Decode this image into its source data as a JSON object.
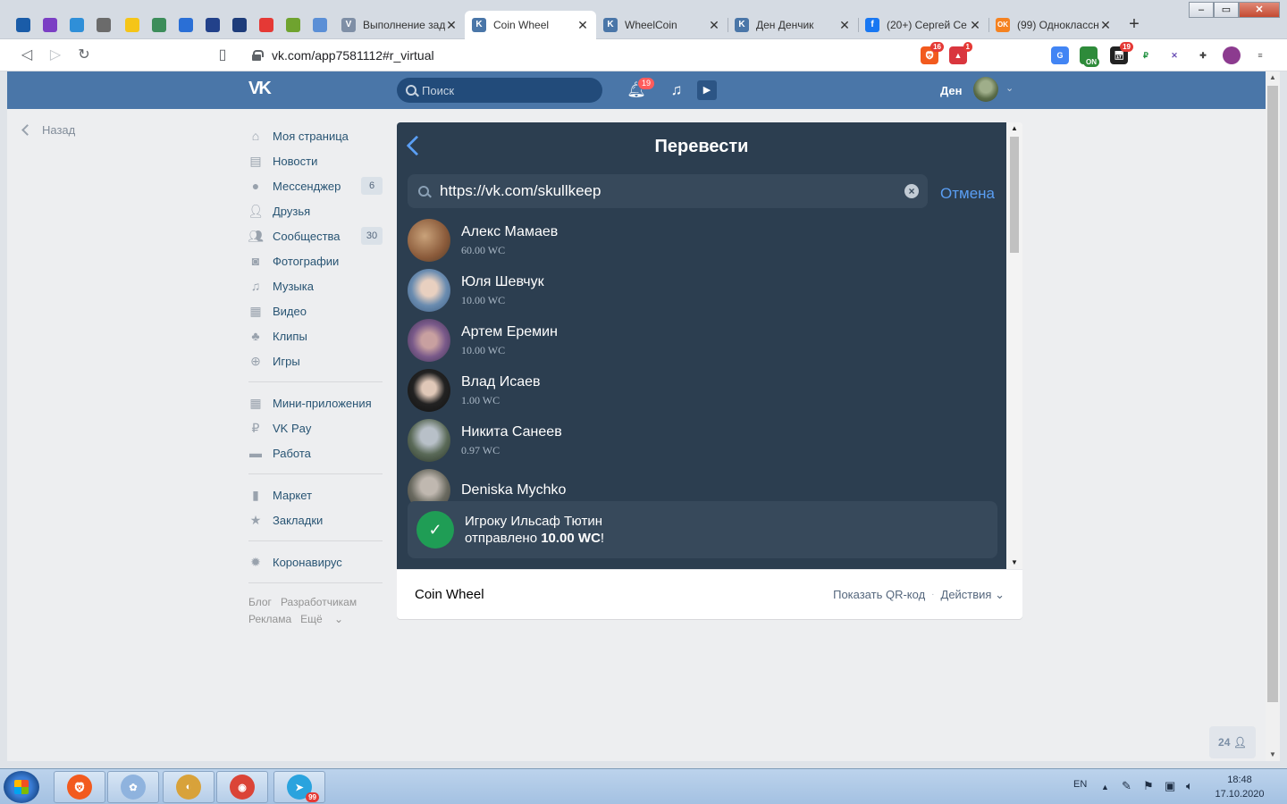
{
  "browser": {
    "pinned_tabs": [
      {
        "icon": "pin-app-1-icon",
        "color": "#1a5ca8"
      },
      {
        "icon": "pin-app-2-icon",
        "color": "#7b3fc4"
      },
      {
        "icon": "pin-app-3-icon",
        "color": "#2f8fd8"
      },
      {
        "icon": "pin-app-4-icon",
        "color": "#6b6b6b"
      },
      {
        "icon": "pin-app-5-icon",
        "color": "#f5c518"
      },
      {
        "icon": "pin-app-6-icon",
        "color": "#3c8d5a"
      },
      {
        "icon": "pin-app-7-icon",
        "color": "#2a6fd6"
      },
      {
        "icon": "pin-app-8-icon",
        "color": "#22418a"
      },
      {
        "icon": "pin-app-9-icon",
        "color": "#1e3c7a"
      },
      {
        "icon": "pin-app-10-icon",
        "color": "#e53935"
      },
      {
        "icon": "pin-app-11-icon",
        "color": "#6fa32f"
      },
      {
        "icon": "pin-app-12-icon",
        "color": "#5b8fd6"
      }
    ],
    "tabs": [
      {
        "title": "Выполнение зад",
        "icon": "v-icon",
        "active": false
      },
      {
        "title": "Coin Wheel",
        "icon": "vk-icon",
        "active": true
      },
      {
        "title": "WheelCoin",
        "icon": "vk-icon",
        "active": false
      },
      {
        "title": "Ден Денчик",
        "icon": "vk-icon",
        "active": false
      },
      {
        "title": "(20+) Сергей Се",
        "icon": "facebook-icon",
        "active": false
      },
      {
        "title": "(99) Одноклассн",
        "icon": "odnoklassniki-icon",
        "active": false
      }
    ],
    "address": "vk.com/app7581112#r_virtual",
    "extensions": [
      {
        "name": "brave-shield-icon",
        "badge": "16"
      },
      {
        "name": "brave-rewards-icon",
        "badge": "1"
      },
      {
        "name": "translate-icon",
        "badge": ""
      },
      {
        "name": "on-toggle-icon",
        "badge": "ON"
      },
      {
        "name": "calendar-icon",
        "badge": "19"
      },
      {
        "name": "ruble-icon",
        "badge": ""
      },
      {
        "name": "crossed-icon",
        "badge": ""
      },
      {
        "name": "puzzle-icon",
        "badge": ""
      },
      {
        "name": "profile-icon",
        "badge": ""
      },
      {
        "name": "menu-icon",
        "badge": ""
      }
    ]
  },
  "vk": {
    "search_placeholder": "Поиск",
    "notifications_count": "19",
    "username": "Ден",
    "back_label": "Назад",
    "menu": [
      {
        "label": "Моя страница",
        "icon": "home-icon",
        "count": ""
      },
      {
        "label": "Новости",
        "icon": "news-icon",
        "count": ""
      },
      {
        "label": "Мессенджер",
        "icon": "messenger-icon",
        "count": "6"
      },
      {
        "label": "Друзья",
        "icon": "friends-icon",
        "count": ""
      },
      {
        "label": "Сообщества",
        "icon": "communities-icon",
        "count": "30"
      },
      {
        "label": "Фотографии",
        "icon": "camera-icon",
        "count": ""
      },
      {
        "label": "Музыка",
        "icon": "music-icon",
        "count": ""
      },
      {
        "label": "Видео",
        "icon": "video-icon",
        "count": ""
      },
      {
        "label": "Клипы",
        "icon": "clips-icon",
        "count": ""
      },
      {
        "label": "Игры",
        "icon": "gamepad-icon",
        "count": ""
      }
    ],
    "menu2": [
      {
        "label": "Мини-приложения",
        "icon": "mini-apps-icon"
      },
      {
        "label": "VK Pay",
        "icon": "vk-pay-icon"
      },
      {
        "label": "Работа",
        "icon": "briefcase-icon"
      }
    ],
    "menu3": [
      {
        "label": "Маркет",
        "icon": "bag-icon"
      },
      {
        "label": "Закладки",
        "icon": "star-icon"
      }
    ],
    "menu4": [
      {
        "label": "Коронавирус",
        "icon": "virus-icon"
      }
    ],
    "footer_links": {
      "blog": "Блог",
      "devs": "Разработчикам",
      "ads": "Реклама",
      "more": "Ещё"
    },
    "online_count": "24"
  },
  "app": {
    "title": "Перевести",
    "search_value": "https://vk.com/skullkeep",
    "cancel": "Отмена",
    "users": [
      {
        "name": "Алекс Мамаев",
        "balance": "60.00 WC"
      },
      {
        "name": "Юля Шевчук",
        "balance": "10.00 WC"
      },
      {
        "name": "Артем Еремин",
        "balance": "10.00 WC"
      },
      {
        "name": "Влад Исаев",
        "balance": "1.00 WC"
      },
      {
        "name": "Никита Санеев",
        "balance": "0.97 WC"
      },
      {
        "name": "Deniska Mychko",
        "balance": ""
      }
    ],
    "toast": {
      "line1": "Игроку Ильсаф Тютин",
      "line2_prefix": "отправлено ",
      "amount": "10.00 WC",
      "line2_suffix": "!"
    },
    "footer": {
      "name": "Coin Wheel",
      "qr": "Показать QR-код",
      "actions": "Действия"
    }
  },
  "taskbar": {
    "apps": [
      {
        "icon": "brave-icon",
        "color": "#f25a1e",
        "badge": ""
      },
      {
        "icon": "paint-icon",
        "color": "#8fb3de",
        "badge": ""
      },
      {
        "icon": "chromium-icon",
        "color": "#d8a23a",
        "badge": ""
      },
      {
        "icon": "chrome-icon",
        "color": "#db4437",
        "badge": ""
      },
      {
        "icon": "telegram-icon",
        "color": "#2aa3de",
        "badge": "99"
      }
    ],
    "language": "EN",
    "time": "18:48",
    "date": "17.10.2020"
  }
}
